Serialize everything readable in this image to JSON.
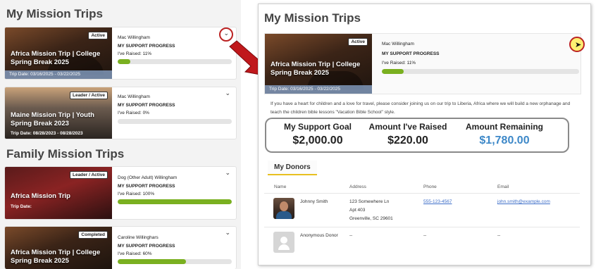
{
  "left": {
    "section1_title": "My Mission Trips",
    "section2_title": "Family Mission Trips",
    "cards": [
      {
        "badge": "Active",
        "title": "Africa Mission Trip | College Spring Break 2025",
        "date": "Trip Date: 03/16/2025 - 03/22/2025",
        "name": "Mac Willingham",
        "progress_label": "MY SUPPORT PROGRESS",
        "raised": "I've Raised: 11%",
        "progress": 0.11
      },
      {
        "badge": "Leader / Active",
        "title": "Maine Mission Trip | Youth Spring Break 2023",
        "date": "Trip Date: 08/28/2023 - 08/28/2023",
        "name": "Mac Willingham",
        "progress_label": "MY SUPPORT PROGRESS",
        "raised": "I've Raised: 0%",
        "progress": 0.0
      },
      {
        "badge": "Leader / Active",
        "title": "Africa Mission Trip",
        "date": "Trip Date:",
        "name": "Dog (Other Adult) Willingham",
        "progress_label": "MY SUPPORT PROGRESS",
        "raised": "I've Raised: 100%",
        "progress": 1.0
      },
      {
        "badge": "Completed",
        "title": "Africa Mission Trip | College Spring Break 2025",
        "date": "",
        "name": "Caroline Willinghars",
        "progress_label": "MY SUPPORT PROGRESS",
        "raised": "I've Raised: 60%",
        "progress": 0.6
      }
    ],
    "chevron": "⌄"
  },
  "right": {
    "title": "My Mission Trips",
    "card": {
      "badge": "Active",
      "title": "Africa Mission Trip | College Spring Break 2025",
      "date": "Trip Date: 03/16/2025 - 03/22/2025",
      "name": "Mac Willingham",
      "progress_label": "MY SUPPORT PROGRESS",
      "raised": "I've Raised: 11%",
      "progress": 0.11
    },
    "description": "If you have a heart for children and a love for travel, please consider joining us on our trip to Liberia, Africa where we will build a new orphanage and teach the children bible lessons \"Vacation Bible School\" style.",
    "stats": [
      {
        "label": "My Support Goal",
        "value": "$2,000.00"
      },
      {
        "label": "Amount  I've Raised",
        "value": "$220.00"
      },
      {
        "label": "Amount  Remaining",
        "value": "$1,780.00"
      }
    ],
    "donors": {
      "tab": "My Donors",
      "columns": [
        "Name",
        "Address",
        "Phone",
        "Email"
      ],
      "rows": [
        {
          "name": "Johnny Smith",
          "address1": "123 Somewhere Ln",
          "address2": "Apt 403",
          "address3": "Greenville, SC 29601",
          "phone": "555-123-4567",
          "email": "john.smith@example.com"
        },
        {
          "name": "Anonymous Donor",
          "address1": "--",
          "phone": "--",
          "email": "--"
        }
      ]
    }
  },
  "colors": {
    "progress_green": "#7ab020",
    "remaining_blue": "#3d88c8",
    "highlight_red": "#b22222"
  }
}
